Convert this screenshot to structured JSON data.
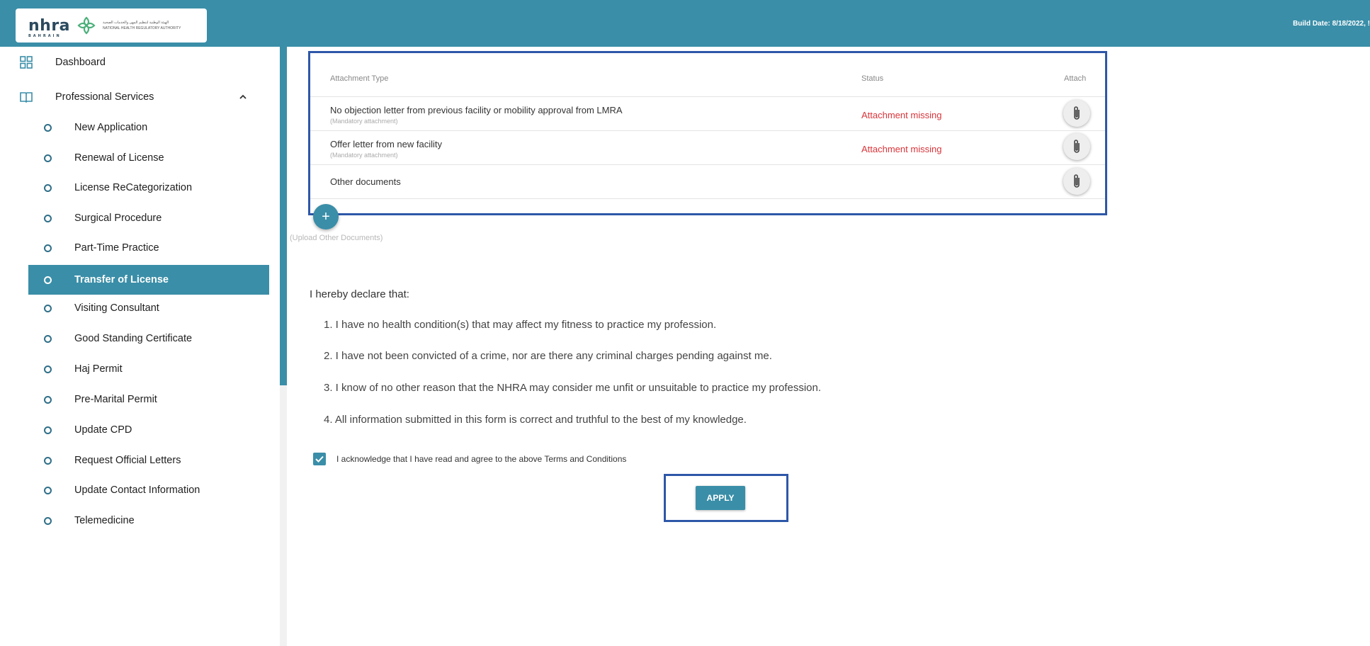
{
  "header": {
    "logo_word": "nhra",
    "logo_sub": "BAHRAIN",
    "logo_arabic": "الهيئة الوطنية لتنظيم المهن والخدمات الصحية",
    "logo_english": "NATIONAL HEALTH REGULATORY AUTHORITY",
    "build_date": "Build Date: 8/18/2022, !"
  },
  "sidebar": {
    "top_items": [
      {
        "label": "Dashboard",
        "icon": "grid-icon"
      },
      {
        "label": "Professional Services",
        "icon": "book-icon"
      }
    ],
    "sub_items": [
      {
        "label": "New Application"
      },
      {
        "label": "Renewal of License"
      },
      {
        "label": "License ReCategorization"
      },
      {
        "label": "Surgical Procedure"
      },
      {
        "label": "Part-Time Practice"
      },
      {
        "label": "Transfer of License",
        "active": true
      },
      {
        "label": "Visiting Consultant"
      },
      {
        "label": "Good Standing Certificate"
      },
      {
        "label": "Haj Permit"
      },
      {
        "label": "Pre-Marital Permit"
      },
      {
        "label": "Update CPD"
      },
      {
        "label": "Request Official Letters"
      },
      {
        "label": "Update Contact Information"
      },
      {
        "label": "Telemedicine"
      }
    ]
  },
  "attachments": {
    "headers": {
      "type": "Attachment Type",
      "status": "Status",
      "attach": "Attach"
    },
    "rows": [
      {
        "title": "No objection letter from previous facility or mobility approval from LMRA",
        "note": "(Mandatory attachment)",
        "status": "Attachment missing"
      },
      {
        "title": "Offer letter from new facility",
        "note": "(Mandatory attachment)",
        "status": "Attachment missing"
      },
      {
        "title": "Other documents",
        "note": "",
        "status": ""
      }
    ],
    "upload_label": "(Upload Other Documents)",
    "colors": {
      "status_missing": "#d9343a",
      "accent": "#3a8ea8",
      "highlight": "#2e57a8"
    }
  },
  "declaration": {
    "title": "I hereby declare that:",
    "items": [
      "1. I have no health condition(s) that may affect my fitness to practice my profession.",
      "2. I have not been convicted of a crime, nor are there any criminal charges pending against me.",
      "3. I know of no other reason that the NHRA may consider me unfit or unsuitable to practice my profession.",
      "4. All information submitted in this form is correct and truthful to the best of my knowledge."
    ],
    "acknowledge_label": "I acknowledge that I have read and agree to the above Terms and Conditions",
    "acknowledged": true
  },
  "actions": {
    "apply_label": "APPLY"
  }
}
